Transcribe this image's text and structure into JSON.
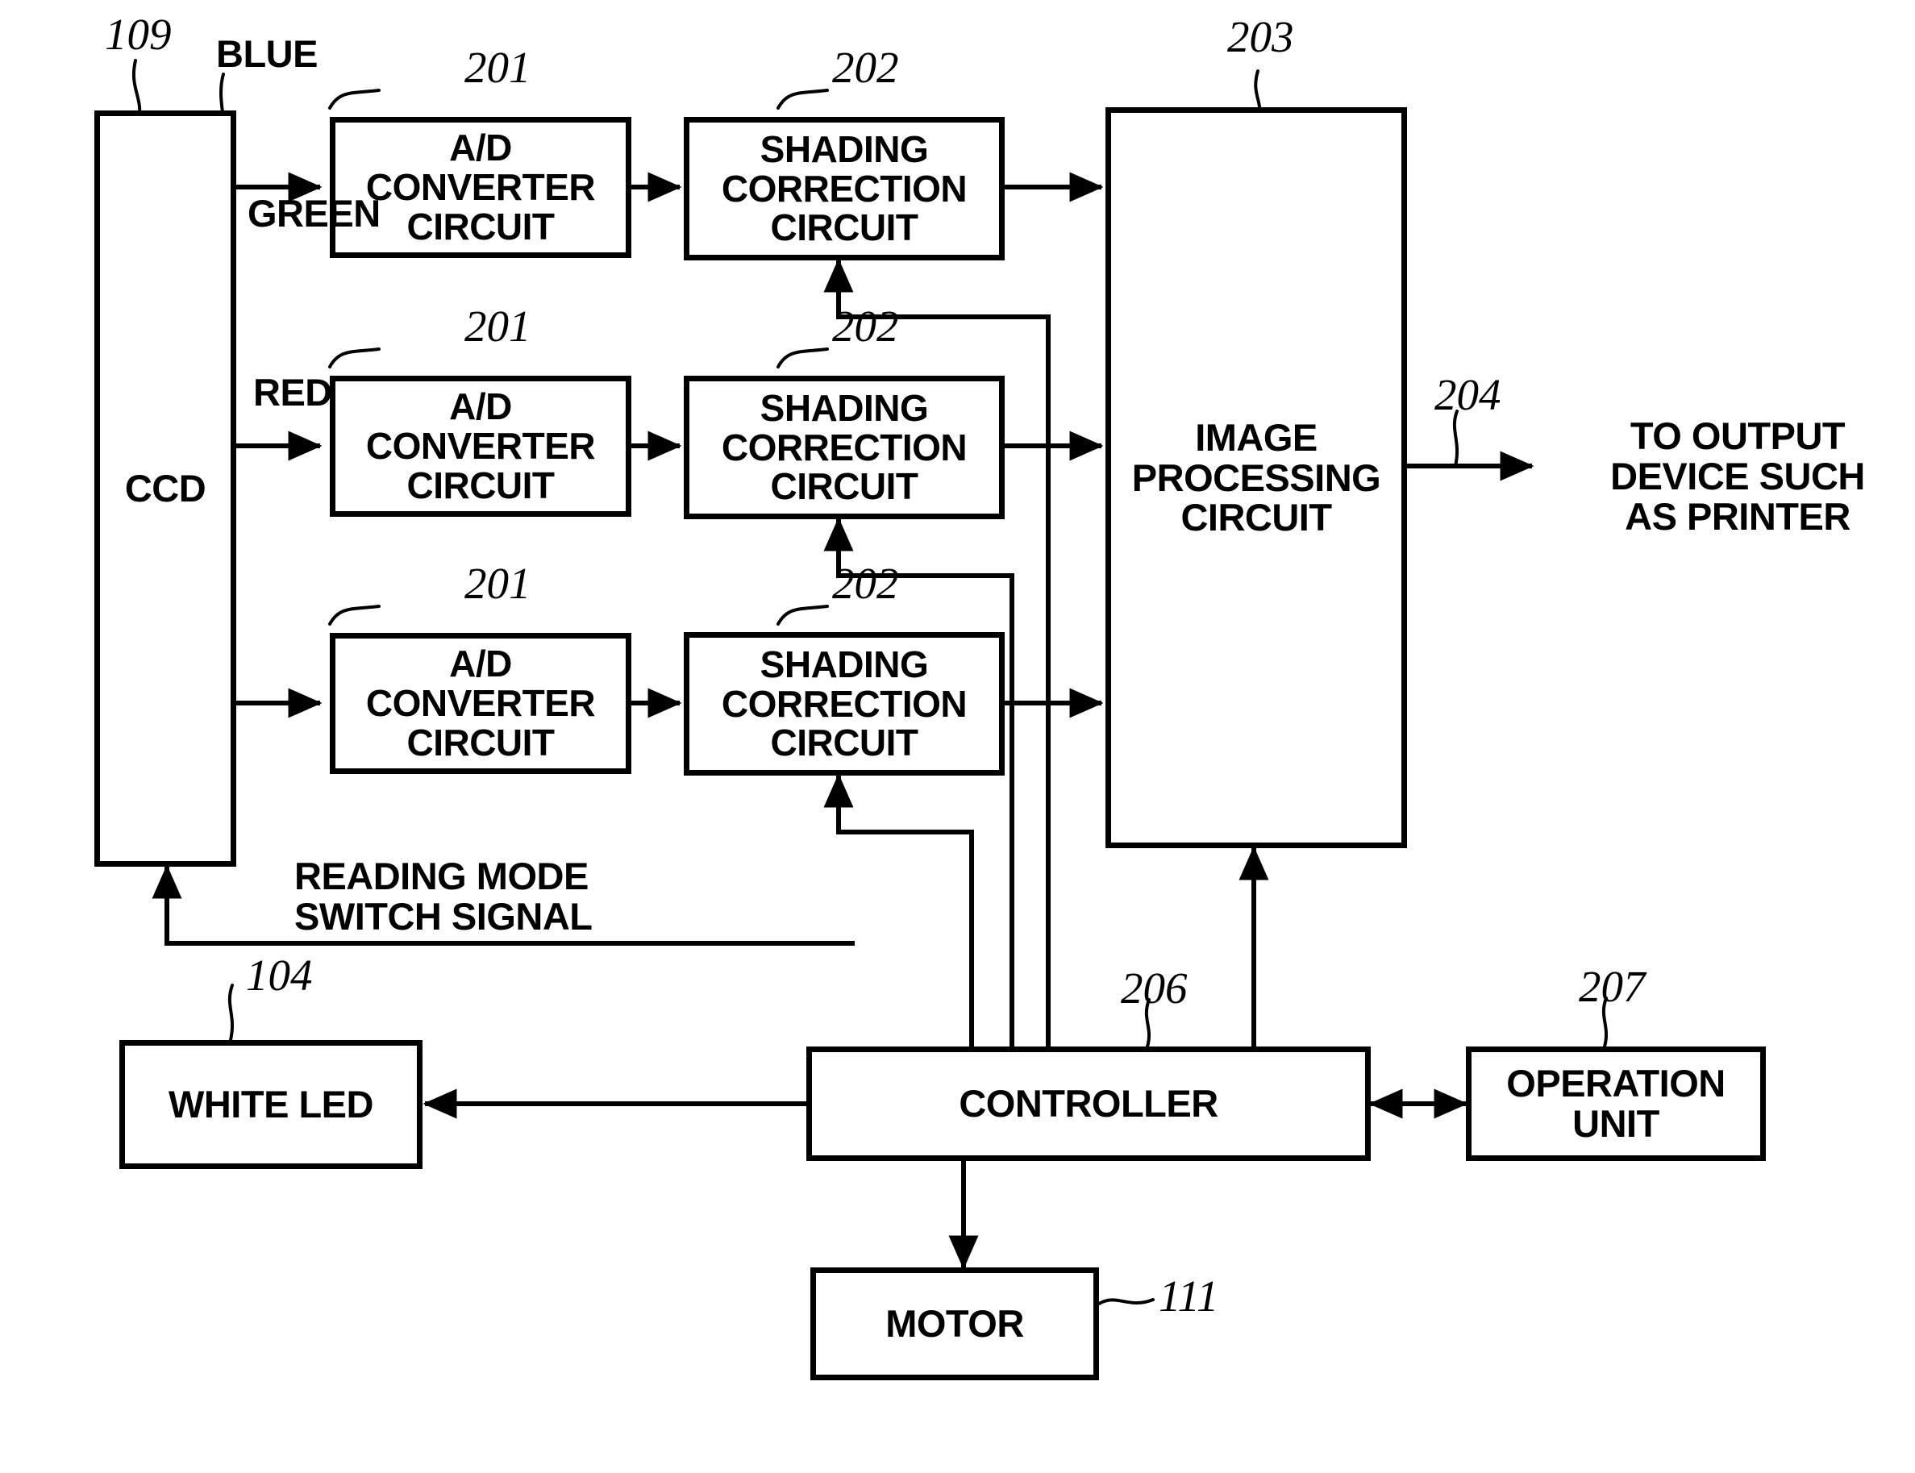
{
  "figure": {
    "type": "block-diagram",
    "title": "Image reading apparatus block diagram"
  },
  "blocks": {
    "ccd": {
      "label": "CCD",
      "ref": "109"
    },
    "ad_blue": {
      "label": "A/D\nCONVERTER\nCIRCUIT",
      "ref": "201"
    },
    "ad_green": {
      "label": "A/D\nCONVERTER\nCIRCUIT",
      "ref": "201"
    },
    "ad_red": {
      "label": "A/D\nCONVERTER\nCIRCUIT",
      "ref": "201"
    },
    "shading_blue": {
      "label": "SHADING\nCORRECTION\nCIRCUIT",
      "ref": "202"
    },
    "shading_green": {
      "label": "SHADING\nCORRECTION\nCIRCUIT",
      "ref": "202"
    },
    "shading_red": {
      "label": "SHADING\nCORRECTION\nCIRCUIT",
      "ref": "202"
    },
    "image_processing": {
      "label": "IMAGE\nPROCESSING\nCIRCUIT",
      "ref": "203"
    },
    "white_led": {
      "label": "WHITE LED",
      "ref": "104"
    },
    "controller": {
      "label": "CONTROLLER",
      "ref": "206"
    },
    "operation_unit": {
      "label": "OPERATION\nUNIT",
      "ref": "207"
    },
    "motor": {
      "label": "MOTOR",
      "ref": "111"
    }
  },
  "signal_labels": {
    "blue": "BLUE",
    "green": "GREEN",
    "red": "RED",
    "reading_mode": "READING MODE\nSWITCH SIGNAL",
    "output": "TO OUTPUT\nDEVICE SUCH\nAS PRINTER",
    "output_ref": "204"
  },
  "colors": {
    "line": "#000000",
    "background": "#ffffff",
    "text": "#000000"
  }
}
